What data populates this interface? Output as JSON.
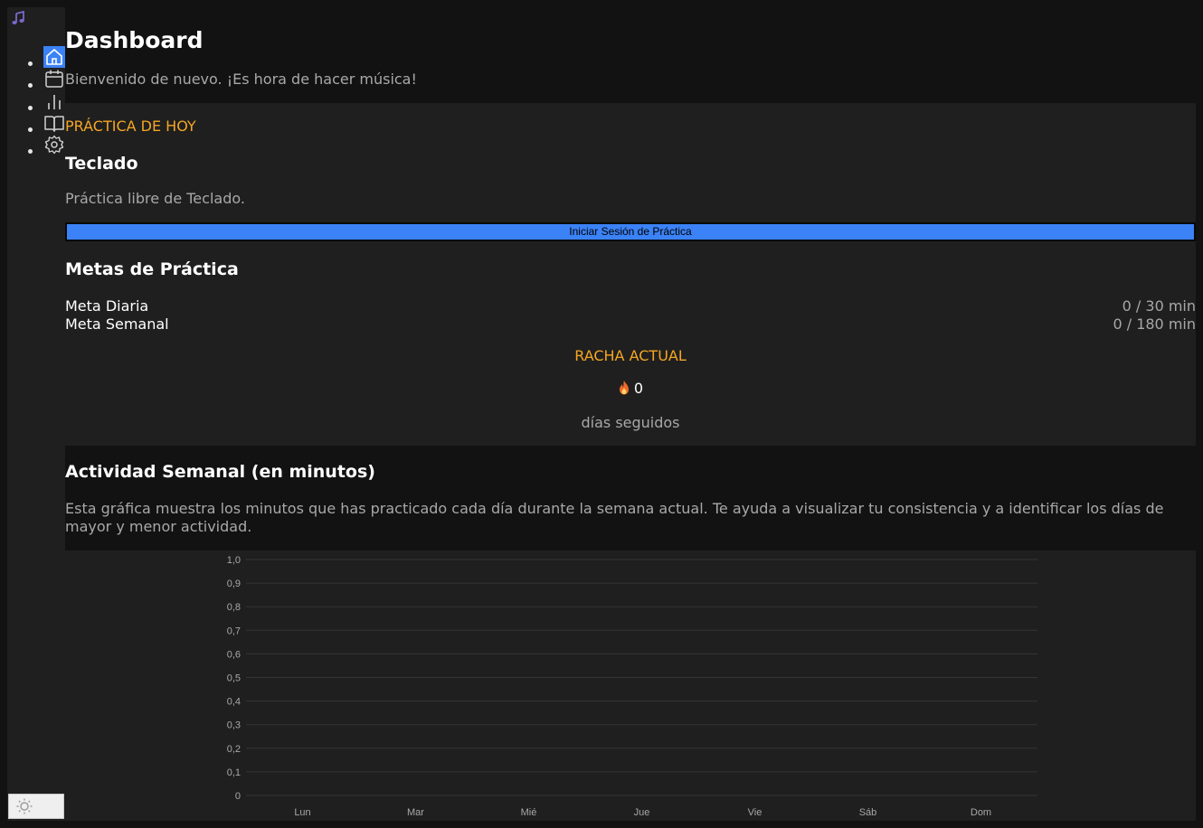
{
  "app": {
    "accent_color": "#3b82f6",
    "highlight_color": "#f5a623"
  },
  "sidebar": {
    "logo_icon": "music-note-icon",
    "items": [
      {
        "icon": "home-icon",
        "active": true
      },
      {
        "icon": "calendar-icon",
        "active": false
      },
      {
        "icon": "bar-chart-icon",
        "active": false
      },
      {
        "icon": "book-icon",
        "active": false
      },
      {
        "icon": "gear-icon",
        "active": false
      }
    ],
    "theme_toggle_icon": "sun-icon"
  },
  "header": {
    "title": "Dashboard",
    "subtitle": "Bienvenido de nuevo. ¡Es hora de hacer música!"
  },
  "today": {
    "kicker": "PRÁCTICA DE HOY",
    "instrument": "Teclado",
    "description": "Práctica libre de Teclado.",
    "start_button": "Iniciar Sesión de Práctica"
  },
  "goals": {
    "title": "Metas de Práctica",
    "daily_label": "Meta Diaria",
    "daily_value": "0 / 30 min",
    "weekly_label": "Meta Semanal",
    "weekly_value": "0 / 180 min"
  },
  "streak": {
    "kicker": "RACHA ACTUAL",
    "icon": "fire-icon",
    "value": "0",
    "label": "días seguidos"
  },
  "activity": {
    "title": "Actividad Semanal (en minutos)",
    "description": "Esta gráfica muestra los minutos que has practicado cada día durante la semana actual. Te ayuda a visualizar tu consistencia y a identificar los días de mayor y menor actividad."
  },
  "chart_data": {
    "type": "bar",
    "categories": [
      "Lun",
      "Mar",
      "Mié",
      "Jue",
      "Vie",
      "Sáb",
      "Dom"
    ],
    "values": [
      0,
      0,
      0,
      0,
      0,
      0,
      0
    ],
    "yticks": [
      "0",
      "0,1",
      "0,2",
      "0,3",
      "0,4",
      "0,5",
      "0,6",
      "0,7",
      "0,8",
      "0,9",
      "1,0"
    ],
    "ylim": [
      0,
      1
    ],
    "grid": true,
    "title": "",
    "xlabel": "",
    "ylabel": ""
  }
}
